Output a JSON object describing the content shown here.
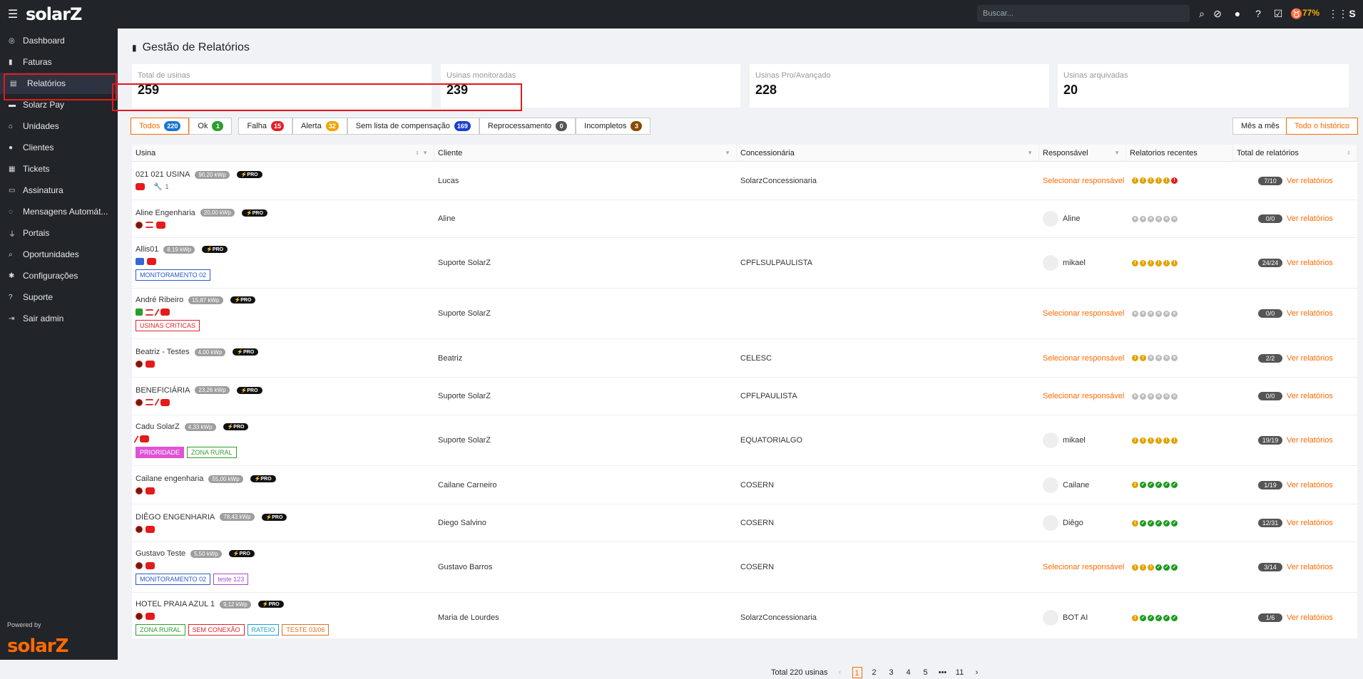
{
  "topbar": {
    "logo": "solarZ",
    "search_placeholder": "Buscar...",
    "battery": "77%"
  },
  "sidebar": {
    "items": [
      {
        "icon": "dashboard-icon",
        "label": "Dashboard",
        "glyph": "◎"
      },
      {
        "icon": "invoice-icon",
        "label": "Faturas",
        "glyph": "▮"
      },
      {
        "icon": "report-icon",
        "label": "Relatórios",
        "glyph": "▤"
      },
      {
        "icon": "pay-icon",
        "label": "Solarz Pay",
        "glyph": "▬"
      },
      {
        "icon": "home-icon",
        "label": "Unidades",
        "glyph": "⌂"
      },
      {
        "icon": "user-icon",
        "label": "Clientes",
        "glyph": "●"
      },
      {
        "icon": "ticket-icon",
        "label": "Tickets",
        "glyph": "▦"
      },
      {
        "icon": "card-icon",
        "label": "Assinatura",
        "glyph": "▭"
      },
      {
        "icon": "whatsapp-icon",
        "label": "Mensagens Automát...",
        "glyph": "◌"
      },
      {
        "icon": "plug-icon",
        "label": "Portais",
        "glyph": "⏚"
      },
      {
        "icon": "search-icon",
        "label": "Oportunidades",
        "glyph": "⌕"
      },
      {
        "icon": "gear-icon",
        "label": "Configurações",
        "glyph": "✱"
      },
      {
        "icon": "question-icon",
        "label": "Suporte",
        "glyph": "?"
      },
      {
        "icon": "logout-icon",
        "label": "Sair admin",
        "glyph": "⇥"
      }
    ],
    "powered": "Powered by",
    "bottom_logo": "solarZ"
  },
  "page": {
    "title": "Gestão de Relatórios"
  },
  "cards": [
    {
      "label": "Total de usinas",
      "value": "259"
    },
    {
      "label": "Usinas monitoradas",
      "value": "239"
    },
    {
      "label": "Usinas Pro/Avançado",
      "value": "228"
    },
    {
      "label": "Usinas arquivadas",
      "value": "20"
    }
  ],
  "filters": [
    {
      "label": "Todos",
      "count": "220",
      "color": "#1976d2"
    },
    {
      "label": "Ok",
      "count": "1",
      "color": "#2e9e2e"
    },
    {
      "label": "Falha",
      "count": "15",
      "color": "#e0222b"
    },
    {
      "label": "Alerta",
      "count": "32",
      "color": "#f0a500"
    },
    {
      "label": "Sem lista de compensação",
      "count": "169",
      "color": "#1a3fd0"
    },
    {
      "label": "Reprocessamento",
      "count": "0",
      "color": "#555"
    },
    {
      "label": "Incompletos",
      "count": "3",
      "color": "#8a4a00"
    }
  ],
  "views": {
    "monthly": "Mês a mês",
    "all": "Todo o histórico"
  },
  "table": {
    "headers": [
      "Usina",
      "Cliente",
      "Concessionária",
      "Responsável",
      "Relatorios recentes",
      "Total de relatórios"
    ],
    "select_label": "Selecionar responsável",
    "view_label": "Ver relatórios",
    "rows": [
      {
        "name": "021 021 USINA",
        "kw": "90,20 kWp",
        "client": "Lucas",
        "conc": "SolarzConcessionaria",
        "resp": "",
        "total": "7/10",
        "wrench": "1",
        "dots": "yyyyyr",
        "tags": [],
        "icons": [
          "red"
        ]
      },
      {
        "name": "Aline Engenharia",
        "kw": "20,00 kWp",
        "client": "Aline",
        "conc": "",
        "resp": "Aline",
        "total": "0/0",
        "dots": "xxxxxx",
        "tags": [],
        "icons": [
          "dark",
          "list",
          "red"
        ]
      },
      {
        "name": "Allis01",
        "kw": "8,19 kWp",
        "client": "Suporte SolarZ",
        "conc": "CPFLSULPAULISTA",
        "resp": "mikael",
        "total": "24/24",
        "dots": "yyyyyy",
        "tags": [
          {
            "t": "MONITORAMENTO 02",
            "c": "#2b59c3"
          }
        ],
        "icons": [
          "blue",
          "red"
        ]
      },
      {
        "name": "André Ribeiro",
        "kw": "15,87 kWp",
        "client": "Suporte SolarZ",
        "conc": "",
        "resp": "",
        "total": "0/0",
        "dots": "xxxxxx",
        "tags": [
          {
            "t": "USINAS CRITICAS",
            "c": "#e0222b"
          }
        ],
        "icons": [
          "green",
          "list",
          "strike",
          "red"
        ]
      },
      {
        "name": "Beatriz - Testes",
        "kw": "4,00 kWp",
        "client": "Beatriz",
        "conc": "CELESC",
        "resp": "",
        "total": "2/2",
        "dots": "yyxxxx",
        "tags": [],
        "icons": [
          "dark",
          "red"
        ]
      },
      {
        "name": "BENEFICIÁRIA",
        "kw": "23,26 kWp",
        "client": "Suporte SolarZ",
        "conc": "CPFLPAULISTA",
        "resp": "",
        "total": "0/0",
        "dots": "xxxxxx",
        "tags": [],
        "icons": [
          "dark",
          "list",
          "strike",
          "red"
        ]
      },
      {
        "name": "Cadu SolarZ",
        "kw": "4,33 kWp",
        "client": "Suporte SolarZ",
        "conc": "EQUATORIALGO",
        "resp": "mikael",
        "total": "19/19",
        "dots": "yyyyyy",
        "tags": [
          {
            "t": "PRIORIDADE",
            "c": "#e052d6",
            "fill": true
          },
          {
            "t": "ZONA RURAL",
            "c": "#2e9e2e"
          }
        ],
        "icons": [
          "strike",
          "red"
        ]
      },
      {
        "name": "Cailane engenharia",
        "kw": "55,00 kWp",
        "client": "Cailane Carneiro",
        "conc": "COSERN",
        "resp": "Cailane",
        "total": "1/19",
        "dots": "yggggg",
        "tags": [],
        "icons": [
          "dark",
          "red"
        ]
      },
      {
        "name": "DIÊGO ENGENHARIA",
        "kw": "78,43 kWp",
        "client": "Diego Salvino",
        "conc": "COSERN",
        "resp": "Diêgo",
        "total": "12/31",
        "dots": "yggggg",
        "tags": [],
        "icons": [
          "dark",
          "red"
        ]
      },
      {
        "name": "Gustavo Teste",
        "kw": "5,50 kWp",
        "client": "Gustavo Barros",
        "conc": "COSERN",
        "resp": "",
        "total": "3/14",
        "dots": "yyyggg",
        "tags": [
          {
            "t": "MONITORAMENTO 02",
            "c": "#2b59c3"
          },
          {
            "t": "teste 123",
            "c": "#a64dc9"
          }
        ],
        "icons": [
          "dark",
          "red"
        ]
      },
      {
        "name": "HOTEL PRAIA AZUL 1",
        "kw": "9,12 kWp",
        "client": "Maria de Lourdes",
        "conc": "SolarzConcessionaria",
        "resp": "BOT AI",
        "total": "1/6",
        "dots": "yggggg",
        "tags": [
          {
            "t": "ZONA RURAL",
            "c": "#2e9e2e"
          },
          {
            "t": "SEM CONEXÃO",
            "c": "#e0222b"
          },
          {
            "t": "RATEIO",
            "c": "#1aa0c8"
          },
          {
            "t": "TESTE 03/06",
            "c": "#e07020"
          }
        ],
        "icons": [
          "dark",
          "red"
        ]
      }
    ]
  },
  "pager": {
    "total": "Total 220 usinas",
    "pages": [
      "1",
      "2",
      "3",
      "4",
      "5",
      "•••",
      "11"
    ],
    "prev": "‹",
    "next": "›"
  }
}
